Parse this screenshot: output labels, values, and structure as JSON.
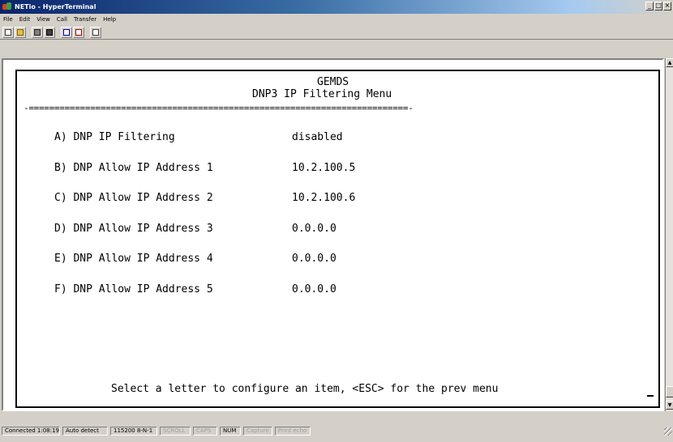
{
  "window": {
    "title": "NETio - HyperTerminal",
    "controls": {
      "minimize": "_",
      "maximize": "□",
      "close": "×"
    }
  },
  "menubar": {
    "items": [
      {
        "label": "File"
      },
      {
        "label": "Edit"
      },
      {
        "label": "View"
      },
      {
        "label": "Call"
      },
      {
        "label": "Transfer"
      },
      {
        "label": "Help"
      }
    ]
  },
  "toolbar": {
    "buttons": [
      {
        "icon": "new-connection-icon"
      },
      {
        "icon": "open-icon"
      },
      {
        "icon": "disconnect-icon"
      },
      {
        "icon": "connect-icon"
      },
      {
        "icon": "send-icon"
      },
      {
        "icon": "receive-icon"
      },
      {
        "icon": "properties-icon"
      }
    ]
  },
  "terminal": {
    "header": "GEMDS",
    "title": "DNP3 IP Filtering Menu",
    "separator": "-==========================================================================-",
    "items": [
      {
        "label": "A) DNP IP Filtering",
        "value": "disabled"
      },
      {
        "label": "B) DNP Allow IP Address 1",
        "value": "10.2.100.5"
      },
      {
        "label": "C) DNP Allow IP Address 2",
        "value": "10.2.100.6"
      },
      {
        "label": "D) DNP Allow IP Address 3",
        "value": "0.0.0.0"
      },
      {
        "label": "E) DNP Allow IP Address 4",
        "value": "0.0.0.0"
      },
      {
        "label": "F) DNP Allow IP Address 5",
        "value": "0.0.0.0"
      }
    ],
    "prompt": "Select a letter to configure an item, <ESC> for the prev menu"
  },
  "scrollbar": {
    "up": "▲",
    "down": "▼"
  },
  "statusbar": {
    "connected": "Connected 1:08:19",
    "detect": "Auto detect",
    "port": "115200 8-N-1",
    "scroll": "SCROLL",
    "caps": "CAPS",
    "num": "NUM",
    "capture": "Capture",
    "print_echo": "Print echo"
  },
  "colors": {
    "titlebar_start": "#0a246a",
    "titlebar_end": "#d4d0c8",
    "chrome": "#d4d0c8",
    "terminal_bg": "#ffffff",
    "terminal_text": "#000000"
  }
}
